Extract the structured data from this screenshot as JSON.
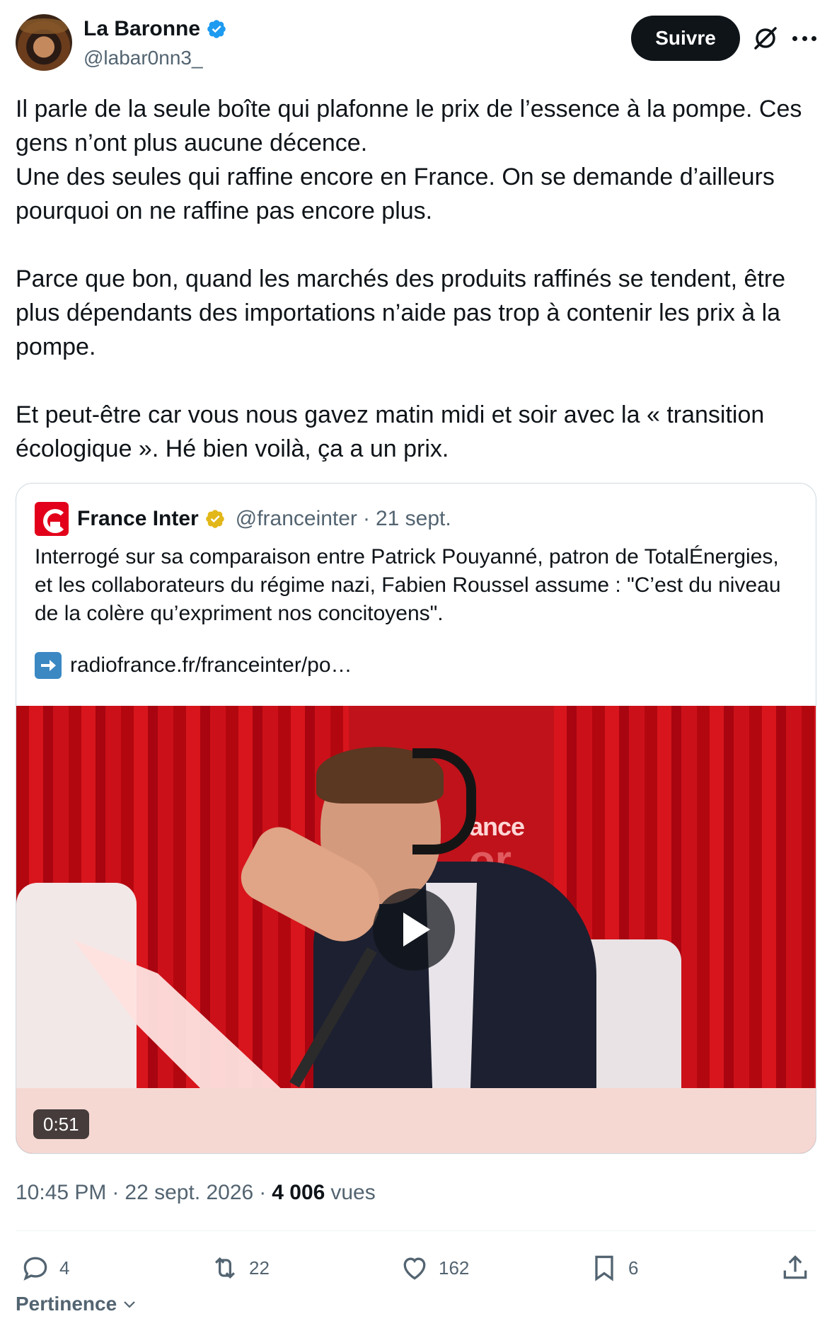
{
  "author": {
    "display_name": "La Baronne",
    "handle": "@labar0nn3_",
    "verified": true
  },
  "header": {
    "follow_label": "Suivre",
    "grok_icon": "grok-icon",
    "more_icon": "more-icon"
  },
  "tweet": {
    "text": "Il parle de la seule boîte qui plafonne le prix de l’essence à la pompe. Ces gens n’ont plus aucune décence.\nUne des seules qui raffine encore en France. On se demande d’ailleurs pourquoi on ne raffine pas encore plus.\n\nParce que bon, quand les marchés des produits raffinés se tendent, être plus dépendants des importations n’aide pas trop à contenir les prix à la pompe.\n\nEt peut-être car vous nous gavez matin midi et soir avec la « transition écologique ». Hé bien voilà, ça a un prix."
  },
  "quote": {
    "display_name": "France Inter",
    "handle": "@franceinter",
    "separator": "·",
    "date": "21 sept.",
    "text": "Interrogé sur sa comparaison entre Patrick Pouyanné, patron de TotalÉnergies, et les collaborateurs du régime nazi, Fabien Roussel assume : \"C’est du niveau de la colère qu’expriment nos concitoyens\".",
    "link_text": "radiofrance.fr/franceinter/po…",
    "video": {
      "duration": "0:51",
      "studio_text_1": "ance",
      "studio_text_2": "or"
    }
  },
  "meta": {
    "time": "10:45 PM",
    "sep1": "·",
    "date": "22 sept. 2026",
    "sep2": "·",
    "views_count": "4 006",
    "views_label": "vues"
  },
  "actions": {
    "replies": "4",
    "reposts": "22",
    "likes": "162",
    "bookmarks": "6"
  },
  "sort": {
    "label": "Pertinence"
  },
  "colors": {
    "text": "#0f1419",
    "secondary": "#536471",
    "verified_blue": "#1d9bf0",
    "verified_gold": "#e2b719",
    "france_inter_red": "#e2001a"
  }
}
